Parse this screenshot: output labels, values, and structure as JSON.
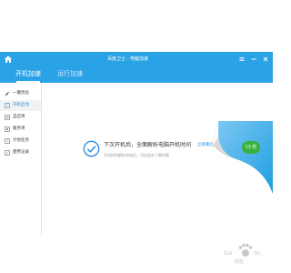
{
  "window": {
    "title": "百度卫士 - 电脑加速"
  },
  "tabs": [
    {
      "label": "开机加速",
      "active": true
    },
    {
      "label": "运行加速",
      "active": false
    }
  ],
  "sidebar": {
    "items": [
      {
        "label": "一键优化",
        "icon": "rocket-icon"
      },
      {
        "label": "开机启动",
        "icon": "power-icon",
        "active": true
      },
      {
        "label": "自启项",
        "icon": "list-icon"
      },
      {
        "label": "服务项",
        "icon": "gear-icon"
      },
      {
        "label": "计划任务",
        "icon": "clock-icon"
      },
      {
        "label": "使用记录",
        "icon": "record-icon"
      }
    ]
  },
  "message": {
    "title": "下次开机后，全面解析电脑开机时间",
    "link": "立即重启",
    "subtitle": "开机时间解析完成后，可在此处了解详情"
  },
  "badge": {
    "text": "13 秒"
  },
  "colors": {
    "titlebar": "#2aa3e6",
    "link": "#2a8cdc",
    "badge": "#3ab13e",
    "curl": "#1e9fe0"
  },
  "watermark": {
    "text": "Bai du 经验",
    "icon": "paw-icon"
  }
}
